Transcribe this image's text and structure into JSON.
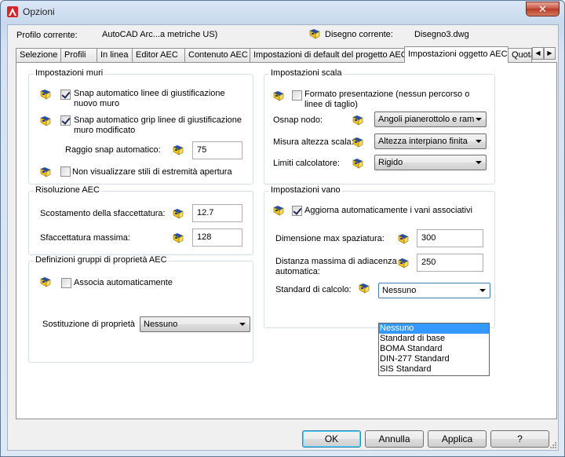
{
  "window": {
    "title": "Opzioni",
    "close_glyph": "✕"
  },
  "profile": {
    "label": "Profilo corrente:",
    "value": "AutoCAD Arc...a metriche US)",
    "drawing_label": "Disegno corrente:",
    "drawing_value": "Disegno3.dwg"
  },
  "tabs": [
    {
      "label": "Selezione"
    },
    {
      "label": "Profili"
    },
    {
      "label": "In linea"
    },
    {
      "label": "Editor AEC"
    },
    {
      "label": "Contenuto AEC"
    },
    {
      "label": "Impostazioni di default del progetto AEC"
    },
    {
      "label": "Impostazioni oggetto AEC",
      "active": true
    },
    {
      "label": "Quota"
    }
  ],
  "tab_scroll": {
    "left": "◀",
    "right": "▶"
  },
  "walls": {
    "title": "Impostazioni muri",
    "snap_lines_label": "Snap automatico linee di giustificazione nuovo muro",
    "snap_lines_checked": true,
    "snap_grips_label": "Snap automatico grip linee di giustificazione muro modificato",
    "snap_grips_checked": true,
    "radius_label": "Raggio snap automatico:",
    "radius_value": "75",
    "no_endcap_label": "Non visualizzare stili di estremità apertura",
    "no_endcap_checked": false
  },
  "aec": {
    "title": "Risoluzione AEC",
    "facet_dev_label": "Scostamento della sfaccettatura:",
    "facet_dev_value": "12.7",
    "facet_max_label": "Sfaccettatura massima:",
    "facet_max_value": "128"
  },
  "psets": {
    "title": "Definizioni gruppi di proprietà AEC",
    "auto_label": "Associa automaticamente",
    "auto_checked": false,
    "subst_label": "Sostituzione di proprietà",
    "subst_value": "Nessuno"
  },
  "stairs": {
    "title": "Impostazioni scala",
    "format_label": "Formato presentazione (nessun percorso o linee di taglio)",
    "format_checked": false,
    "osnap_label": "Osnap nodo:",
    "osnap_value": "Angoli pianerottolo e ram",
    "height_label": "Misura altezza scala:",
    "height_value": "Altezza interpiano finita",
    "calc_label": "Limiti calcolatore:",
    "calc_value": "Rigido"
  },
  "spaces": {
    "title": "Impostazioni vano",
    "update_label": "Aggiorna automaticamente i vani associativi",
    "update_checked": true,
    "max_gap_label": "Dimensione max spaziatura:",
    "max_gap_value": "300",
    "adj_label": "Distanza massima di adiacenza automatica:",
    "adj_value": "250",
    "std_label": "Standard di calcolo:",
    "std_value": "Nessuno",
    "std_options": [
      "Nessuno",
      "Standard di base",
      "BOMA Standard",
      "DIN-277 Standard",
      "SIS Standard"
    ]
  },
  "buttons": {
    "ok": "OK",
    "cancel": "Annulla",
    "apply": "Applica",
    "help": "?"
  },
  "colors": {
    "accent": "#3399ff",
    "app_icon": "#d7262b",
    "close": "#c75846"
  },
  "icons": [
    "drawing-setting-icon",
    "autocad-app-icon",
    "close-icon",
    "chevron-down-icon",
    "size-grip-icon"
  ]
}
